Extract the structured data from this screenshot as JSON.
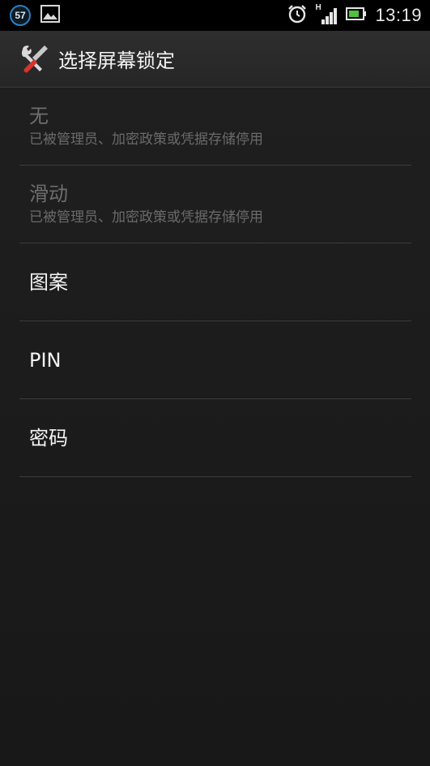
{
  "status_bar": {
    "notification_badge": "57",
    "icons": [
      "notification-count-icon",
      "gallery-image-icon",
      "alarm-clock-icon",
      "signal-h-icon",
      "battery-icon"
    ],
    "network_type": "H",
    "time": "13:19",
    "accent_color": "#2d7fc0"
  },
  "action_bar": {
    "icon": "settings-tools-icon",
    "title": "选择屏幕锁定"
  },
  "options": [
    {
      "title": "无",
      "summary": "已被管理员、加密政策或凭据存储停用",
      "enabled": false
    },
    {
      "title": "滑动",
      "summary": "已被管理员、加密政策或凭据存储停用",
      "enabled": false
    },
    {
      "title": "图案",
      "summary": "",
      "enabled": true
    },
    {
      "title": "PIN",
      "summary": "",
      "enabled": true
    },
    {
      "title": "密码",
      "summary": "",
      "enabled": true
    }
  ]
}
